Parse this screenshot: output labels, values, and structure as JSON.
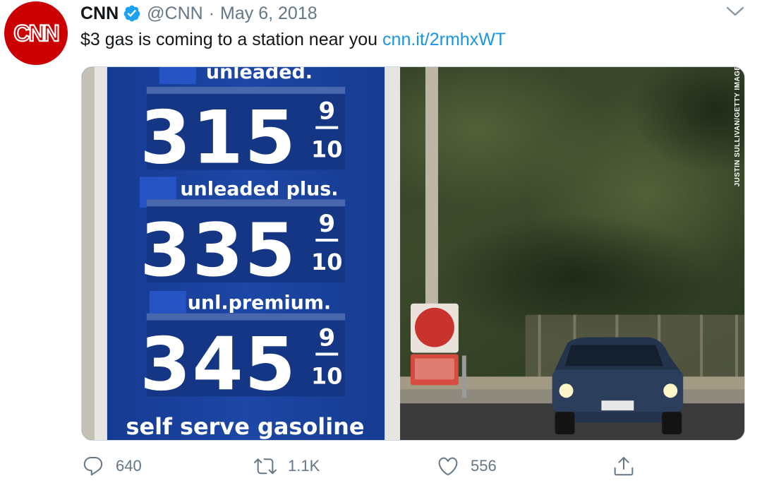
{
  "tweet": {
    "author_name": "CNN",
    "author_handle": "@CNN",
    "separator": "·",
    "date": "May 6, 2018",
    "text": "$3 gas is coming to a station near you",
    "link": "cnn.it/2rmhxWT",
    "logo_text": "CNN"
  },
  "media": {
    "photo_credit": "JUSTIN SULLIVAN/GETTY IMAGES",
    "sign": {
      "rows": [
        {
          "label": "unleaded.",
          "price": "315",
          "frac_top": "9",
          "frac_bottom": "10"
        },
        {
          "label": "unleaded plus.",
          "price": "335",
          "frac_top": "9",
          "frac_bottom": "10"
        },
        {
          "label": "unl.premium.",
          "price": "345",
          "frac_top": "9",
          "frac_bottom": "10"
        }
      ],
      "footer": "self serve gasoline"
    }
  },
  "actions": {
    "replies": "640",
    "retweets": "1.1K",
    "likes": "556"
  },
  "icons": {
    "verified": "verified-badge-icon",
    "menu": "chevron-down-icon",
    "reply": "reply-icon",
    "retweet": "retweet-icon",
    "like": "heart-icon",
    "share": "share-icon"
  },
  "colors": {
    "brand_red": "#cc0000",
    "link_blue": "#1b95e0",
    "muted_gray": "#657786",
    "sign_blue": "#1a3f9a"
  }
}
